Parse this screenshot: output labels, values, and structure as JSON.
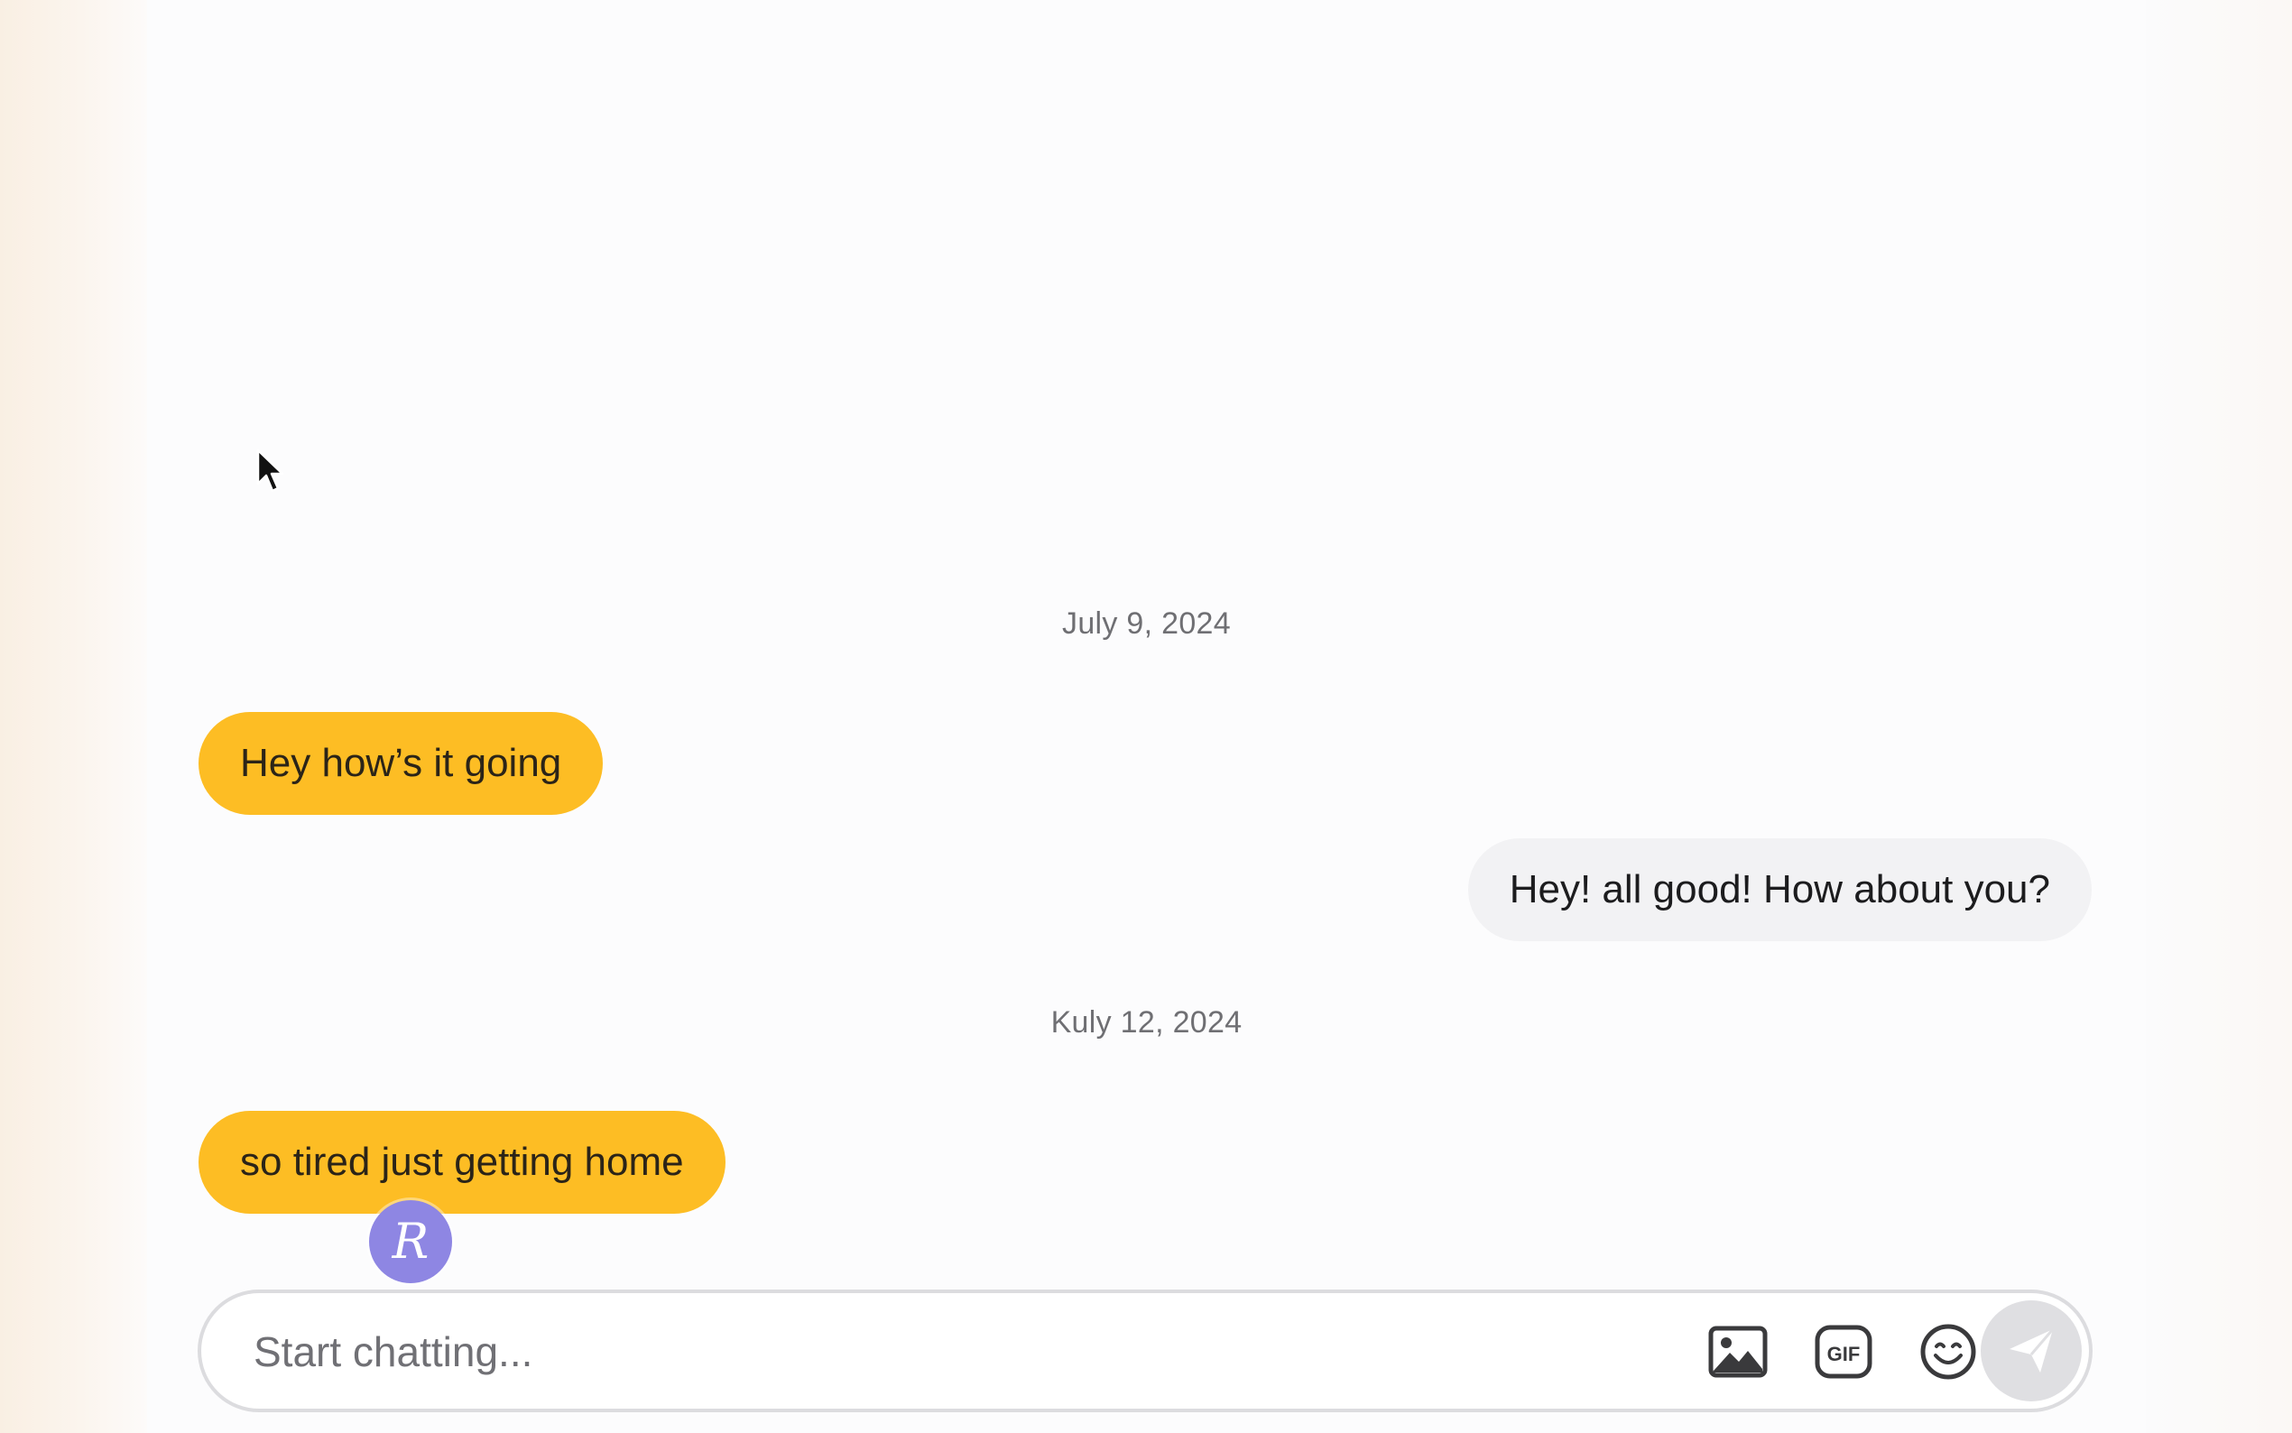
{
  "chat": {
    "dates": [
      "July 9, 2024",
      "Kuly 12, 2024"
    ],
    "messages": [
      {
        "direction": "received",
        "text": "Hey how’s it going"
      },
      {
        "direction": "sent",
        "text": "Hey! all good! How about you?"
      },
      {
        "direction": "received",
        "text": "so tired just getting home"
      }
    ],
    "avatar_letter": "R"
  },
  "composer": {
    "placeholder": "Start chatting...",
    "value": "",
    "tools": [
      "image-icon",
      "gif-icon",
      "emoji-icon"
    ],
    "send_icon": "send-icon"
  },
  "colors": {
    "received_bubble": "#fdbd24",
    "sent_bubble": "#f2f2f4",
    "avatar": "#8e86e3",
    "send_button": "#dfdfe2"
  }
}
